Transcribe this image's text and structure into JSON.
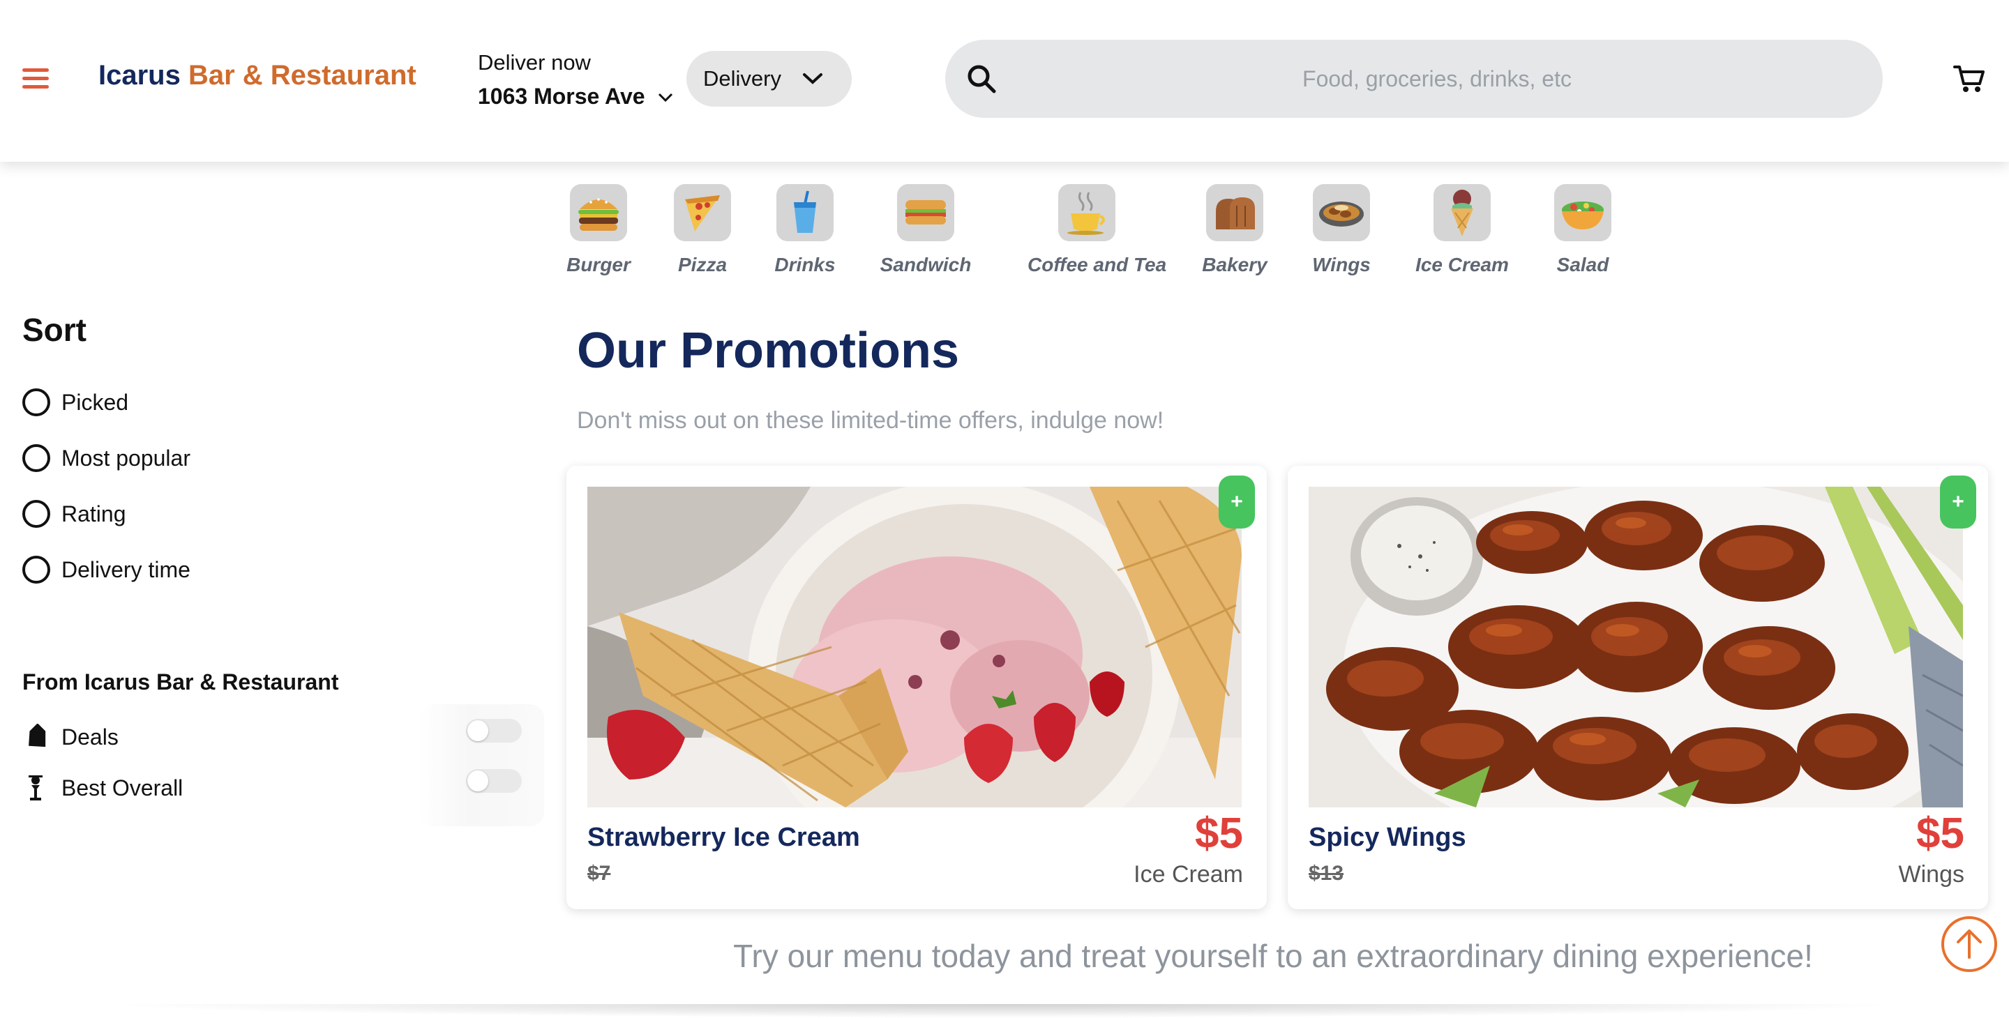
{
  "header": {
    "brand_part1": "Icarus",
    "brand_part2": "Bar & Restaurant",
    "deliver_label": "Deliver now",
    "address": "1063 Morse Ave",
    "mode": "Delivery",
    "search_placeholder": "Food, groceries, drinks, etc",
    "icons": [
      "hamburger-icon",
      "chevron-down-icon",
      "search-icon",
      "cart-icon"
    ]
  },
  "categories": [
    {
      "label": "Burger",
      "icon": "burger-icon"
    },
    {
      "label": "Pizza",
      "icon": "pizza-icon"
    },
    {
      "label": "Drinks",
      "icon": "drink-icon"
    },
    {
      "label": "Sandwich",
      "icon": "sandwich-icon"
    },
    {
      "label": "Coffee and Tea",
      "icon": "coffee-icon"
    },
    {
      "label": "Bakery",
      "icon": "bread-icon"
    },
    {
      "label": "Wings",
      "icon": "wings-icon"
    },
    {
      "label": "Ice Cream",
      "icon": "ice-cream-icon"
    },
    {
      "label": "Salad",
      "icon": "salad-icon"
    }
  ],
  "sidebar": {
    "sort_title": "Sort",
    "sort_options": [
      "Picked",
      "Most popular",
      "Rating",
      "Delivery time"
    ],
    "from_title": "From Icarus Bar & Restaurant",
    "filters": [
      {
        "label": "Deals",
        "icon": "tag-icon",
        "enabled": false
      },
      {
        "label": "Best Overall",
        "icon": "award-icon",
        "enabled": false
      }
    ]
  },
  "promotions": {
    "title": "Our Promotions",
    "subtitle": "Don't miss out on these limited-time offers, indulge now!",
    "items": [
      {
        "name": "Strawberry Ice Cream",
        "old_price": "$7",
        "price": "$5",
        "category": "Ice Cream",
        "add_label": "+"
      },
      {
        "name": "Spicy Wings",
        "old_price": "$13",
        "price": "$5",
        "category": "Wings",
        "add_label": "+"
      }
    ],
    "tagline": "Try our menu today and treat yourself to an extraordinary dining experience!"
  },
  "colors": {
    "brand_navy": "#14285c",
    "brand_orange": "#cf6b2c",
    "price_red": "#e0403a",
    "add_green": "#47c45e",
    "accent_orange": "#e8702c"
  }
}
